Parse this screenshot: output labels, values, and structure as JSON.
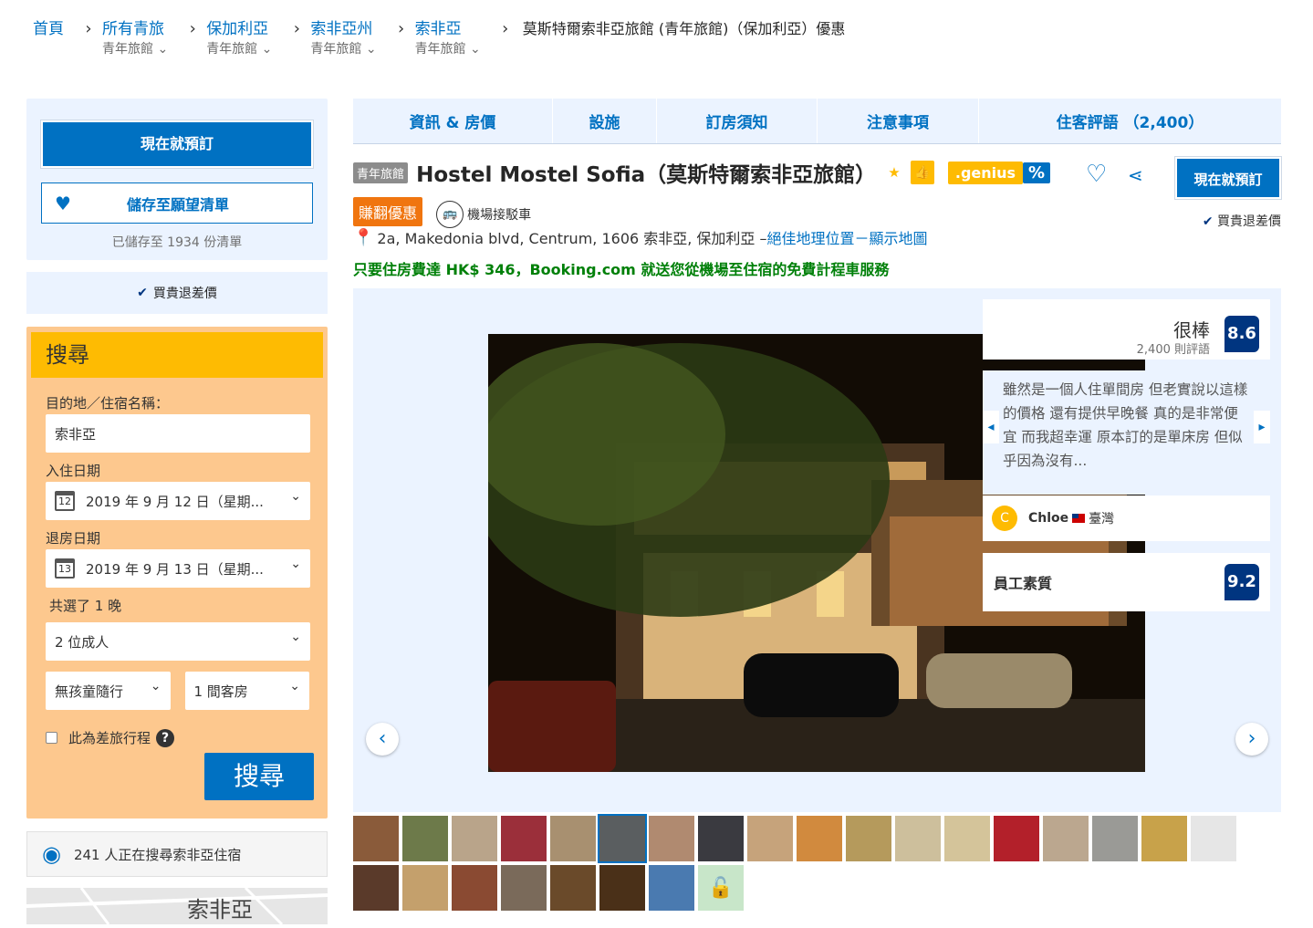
{
  "breadcrumb": {
    "items": [
      {
        "label": "首頁",
        "sub": ""
      },
      {
        "label": "所有青旅",
        "sub": "青年旅館"
      },
      {
        "label": "保加利亞",
        "sub": "青年旅館"
      },
      {
        "label": "索非亞州",
        "sub": "青年旅館"
      },
      {
        "label": "索非亞",
        "sub": "青年旅館"
      }
    ],
    "current": "莫斯特爾索非亞旅館 (青年旅館)（保加利亞）優惠"
  },
  "sidebar": {
    "book_now": "現在就預訂",
    "save_wishlist": "儲存至願望清單",
    "saved_count": "已儲存至 1934 份清單",
    "price_match": "買貴退差價",
    "search": {
      "title": "搜尋",
      "destination_label": "目的地／住宿名稱：",
      "destination_value": "索非亞",
      "checkin_label": "入住日期",
      "checkin_day": "12",
      "checkin_value": "2019 年 9 月 12 日（星期...",
      "checkout_label": "退房日期",
      "checkout_day": "13",
      "checkout_value": "2019 年 9 月 13 日（星期...",
      "nights": "共選了 1 晚",
      "adults": "2 位成人",
      "children": "無孩童隨行",
      "rooms": "1 間客房",
      "business_trip": "此為差旅行程",
      "search_button": "搜尋"
    },
    "lookers": "241 人正在搜尋索非亞住宿",
    "map_label": "索非亞"
  },
  "tabs": [
    "資訊 & 房價",
    "設施",
    "訂房須知",
    "注意事項",
    "住客評語 （2,400）"
  ],
  "hotel": {
    "type_badge": "青年旅館",
    "name": "Hostel Mostel Sofia（莫斯特爾索非亞旅館）",
    "star": "★",
    "genius": ".genius",
    "pct": "%",
    "deal_badge": "賺翻優惠",
    "shuttle": "機場接駁車",
    "address": "2a, Makedonia blvd, Centrum, 1606 索非亞, 保加利亞 – ",
    "address_link": "絕佳地理位置－顯示地圖",
    "taxi_promo": "只要住房費達 HK$ 346，Booking.com 就送您從機場至住宿的免費計程車服務",
    "book_now": "現在就預訂",
    "price_match": "買貴退差價"
  },
  "review_panel": {
    "score_word": "很棒",
    "score_count": "2,400 則評語",
    "score": "8.6",
    "quote": "雖然是一個人住單間房 但老實說以這樣的價格 還有提供早晚餐 真的是非常便宜 而我超幸運 原本訂的是單床房 但似乎因為沒有...",
    "reviewer_initial": "C",
    "reviewer_name": "Chloe",
    "reviewer_country": "臺灣",
    "staff_label": "員工素質",
    "staff_score": "9.2"
  },
  "icons": {
    "heart": "heart-icon",
    "share": "share-icon",
    "pin": "map-pin-icon",
    "eye": "eye-icon",
    "lock": "unlock-icon"
  },
  "colors": {
    "brand_blue": "#0071c2",
    "dark_blue": "#003580",
    "genius_yellow": "#febb02",
    "deal_orange": "#f0750f",
    "promo_green": "#008009"
  }
}
